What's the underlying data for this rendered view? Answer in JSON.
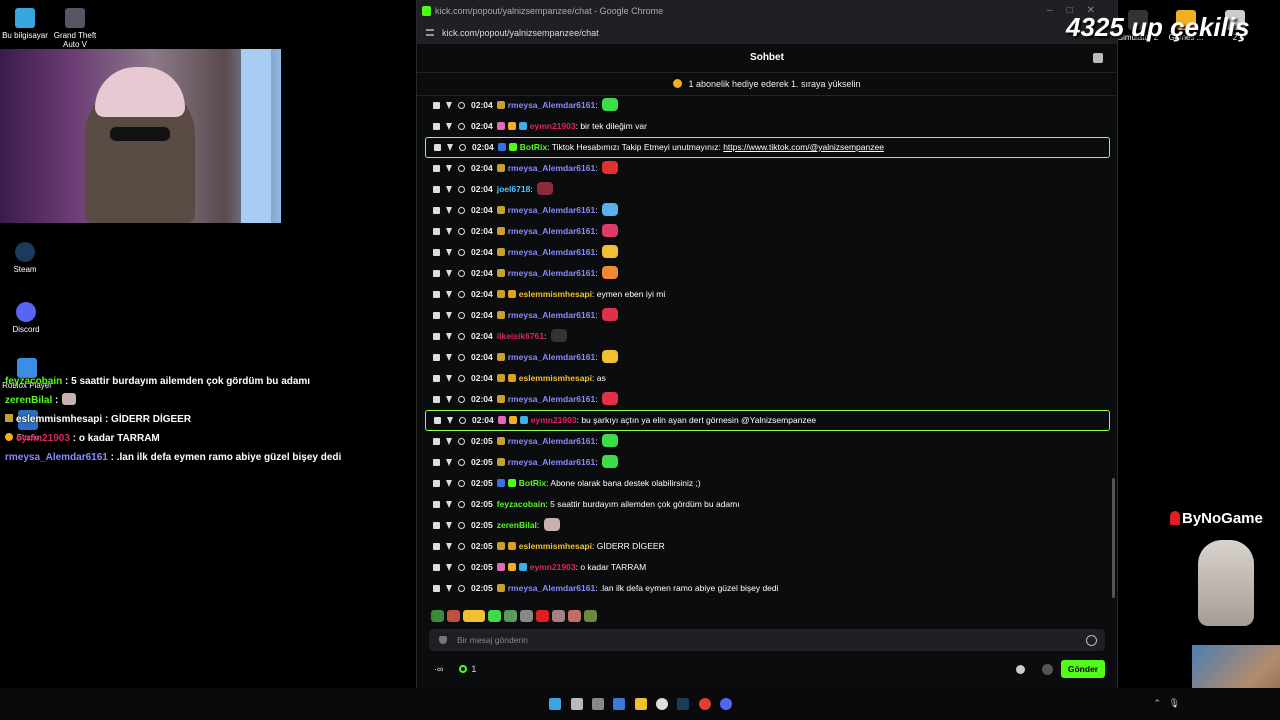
{
  "desktop": {
    "icons_top": [
      {
        "label": "Bu bilgisayar"
      },
      {
        "label": "Grand Theft Auto V"
      }
    ],
    "icons_left": [
      {
        "label": "Steam"
      },
      {
        "label": "Discord"
      },
      {
        "label": "Roblox Player"
      },
      {
        "label": "Studio"
      }
    ],
    "icons_right": [
      {
        "label": "Simulator 2"
      },
      {
        "label": "Games ..."
      },
      {
        "label": "2"
      }
    ]
  },
  "overlay_chat": [
    {
      "user": "feyzacobain",
      "color": "#53fc18",
      "text": ": 5 saattir burdayım ailemden çok gördüm bu adamı"
    },
    {
      "user": "zerenBilal",
      "color": "#53fc18",
      "text": ":"
    },
    {
      "user": "eslemmismhesapi",
      "color": "#ffffff",
      "text": ": GİDERR DİGEER"
    },
    {
      "user": "eymn21903",
      "color": "#e0245e",
      "text": ": o kadar TARRAM"
    },
    {
      "user": "rmeysa_Alemdar6161",
      "color": "#8a8aff",
      "text": ": .lan ilk defa eymen ramo abiye güzel bişey dedi"
    }
  ],
  "browser": {
    "title": "kick.com/popout/yalnizsempanzee/chat - Google Chrome",
    "url": "kick.com/popout/yalnizsempanzee/chat"
  },
  "chat": {
    "header": "Sohbet",
    "pinned": "1 abonelik hediye ederek 1. sıraya yükselin",
    "messages": [
      {
        "time": "02:04",
        "user": "rmeysa_Alemdar6161",
        "ucolor": "#8a8aff",
        "text": "",
        "emote": "#3ddc4a",
        "badges": [
          "#c8a030"
        ]
      },
      {
        "time": "02:04",
        "user": "eymn21903",
        "ucolor": "#e0245e",
        "text": "bir tek dileğim var",
        "emote": "",
        "badges": [
          "#e26ab4",
          "#f0b020",
          "#3bb0e6"
        ]
      },
      {
        "time": "02:04",
        "user": "BotRix",
        "ucolor": "#53fc18",
        "text": "Tiktok Hesabımızı Takip Etmeyi unutmayınız: ",
        "link": "https://www.tiktok.com/@yalnizsempanzee",
        "emote": "",
        "badges": [
          "#3b6fe6",
          "#53fc18"
        ],
        "highlight": true
      },
      {
        "time": "02:04",
        "user": "rmeysa_Alemdar6161",
        "ucolor": "#8a8aff",
        "text": "",
        "emote": "#e03030",
        "badges": [
          "#c8a030"
        ]
      },
      {
        "time": "02:04",
        "user": "joel6718",
        "ucolor": "#4ac8ff",
        "text": "",
        "emote": "#8a2a3a",
        "badges": []
      },
      {
        "time": "02:04",
        "user": "rmeysa_Alemdar6161",
        "ucolor": "#8a8aff",
        "text": "",
        "emote": "#5ab0e8",
        "badges": [
          "#c8a030"
        ]
      },
      {
        "time": "02:04",
        "user": "rmeysa_Alemdar6161",
        "ucolor": "#8a8aff",
        "text": "",
        "emote": "#e03a6a",
        "badges": [
          "#c8a030"
        ]
      },
      {
        "time": "02:04",
        "user": "rmeysa_Alemdar6161",
        "ucolor": "#8a8aff",
        "text": "",
        "emote": "#f0c030",
        "badges": [
          "#c8a030"
        ]
      },
      {
        "time": "02:04",
        "user": "rmeysa_Alemdar6161",
        "ucolor": "#8a8aff",
        "text": "",
        "emote": "#f08a30",
        "badges": [
          "#c8a030"
        ]
      },
      {
        "time": "02:04",
        "user": "eslemmismhesapi",
        "ucolor": "#f0c030",
        "text": "eymen eben iyi mi",
        "emote": "",
        "badges": [
          "#c8a030",
          "#e0a020"
        ]
      },
      {
        "time": "02:04",
        "user": "rmeysa_Alemdar6161",
        "ucolor": "#8a8aff",
        "text": "",
        "emote": "#e0304a",
        "badges": [
          "#c8a030"
        ]
      },
      {
        "time": "02:04",
        "user": "ilkeisik6761",
        "ucolor": "#e0245e",
        "text": "",
        "emote": "#333333",
        "badges": []
      },
      {
        "time": "02:04",
        "user": "rmeysa_Alemdar6161",
        "ucolor": "#8a8aff",
        "text": "",
        "emote": "#f0c030",
        "badges": [
          "#c8a030"
        ]
      },
      {
        "time": "02:04",
        "user": "eslemmismhesapi",
        "ucolor": "#f0c030",
        "text": "as",
        "emote": "",
        "badges": [
          "#c8a030",
          "#e0a020"
        ]
      },
      {
        "time": "02:04",
        "user": "rmeysa_Alemdar6161",
        "ucolor": "#8a8aff",
        "text": "",
        "emote": "#e0304a",
        "badges": [
          "#c8a030"
        ]
      },
      {
        "time": "02:04",
        "user": "eymn21903",
        "ucolor": "#e0245e",
        "text": "bu şarkıyı açtın ya elin ayan dert görnesin @Yalnizsempanzee",
        "emote": "",
        "badges": [
          "#e26ab4",
          "#f0b020",
          "#3bb0e6"
        ],
        "highlight": true
      },
      {
        "time": "02:05",
        "user": "rmeysa_Alemdar6161",
        "ucolor": "#8a8aff",
        "text": "",
        "emote": "#3ddc4a",
        "badges": [
          "#c8a030"
        ]
      },
      {
        "time": "02:05",
        "user": "rmeysa_Alemdar6161",
        "ucolor": "#8a8aff",
        "text": "",
        "emote": "#3ddc4a",
        "badges": [
          "#c8a030"
        ]
      },
      {
        "time": "02:05",
        "user": "BotRix",
        "ucolor": "#53fc18",
        "text": "Abone olarak bana destek olabilirsiniz ;)",
        "emote": "",
        "badges": [
          "#3b6fe6",
          "#53fc18"
        ]
      },
      {
        "time": "02:05",
        "user": "feyzacobain",
        "ucolor": "#53fc18",
        "text": "5 saattir burdayım ailemden çok gördüm bu adamı",
        "emote": "",
        "badges": []
      },
      {
        "time": "02:05",
        "user": "zerenBilal",
        "ucolor": "#53fc18",
        "text": "",
        "emote": "#c8b0b0",
        "badges": []
      },
      {
        "time": "02:05",
        "user": "eslemmismhesapi",
        "ucolor": "#f0c030",
        "text": "GİDERR DİGEER",
        "emote": "",
        "badges": [
          "#c8a030",
          "#e0a020"
        ]
      },
      {
        "time": "02:05",
        "user": "eymn21903",
        "ucolor": "#e0245e",
        "text": "o kadar TARRAM",
        "emote": "",
        "badges": [
          "#e26ab4",
          "#f0b020",
          "#3bb0e6"
        ]
      },
      {
        "time": "02:05",
        "user": "rmeysa_Alemdar6161",
        "ucolor": "#8a8aff",
        "text": ".lan ilk defa eymen ramo abiye güzel bişey dedi",
        "emote": "",
        "badges": [
          "#c8a030"
        ]
      }
    ],
    "input_placeholder": "Bir mesaj gönderin",
    "viewer_count": "1",
    "send_label": "Gönder"
  },
  "overlays": {
    "giveaway": "4325 up çekiliş",
    "sponsor": "ByNoGame"
  },
  "colors": {
    "accent": "#53fc18",
    "window_bg": "#0b0c0e"
  }
}
